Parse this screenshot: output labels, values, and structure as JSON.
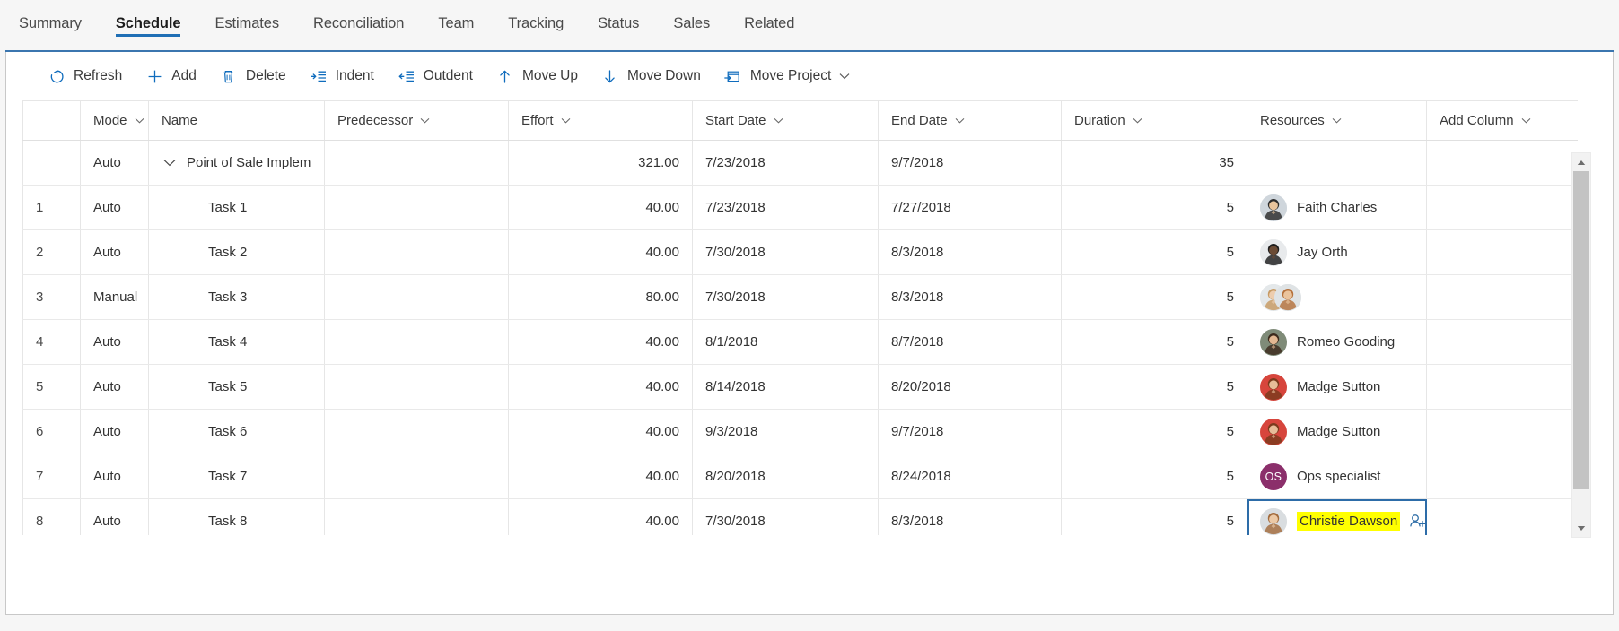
{
  "tabs": [
    {
      "label": "Summary",
      "active": false
    },
    {
      "label": "Schedule",
      "active": true
    },
    {
      "label": "Estimates",
      "active": false
    },
    {
      "label": "Reconciliation",
      "active": false
    },
    {
      "label": "Team",
      "active": false
    },
    {
      "label": "Tracking",
      "active": false
    },
    {
      "label": "Status",
      "active": false
    },
    {
      "label": "Sales",
      "active": false
    },
    {
      "label": "Related",
      "active": false
    }
  ],
  "toolbar": {
    "refresh_label": "Refresh",
    "add_label": "Add",
    "delete_label": "Delete",
    "indent_label": "Indent",
    "outdent_label": "Outdent",
    "move_up_label": "Move Up",
    "move_down_label": "Move Down",
    "move_project_label": "Move Project"
  },
  "grid": {
    "columns": [
      {
        "label": "",
        "chevron": false
      },
      {
        "label": "Mode",
        "chevron": true
      },
      {
        "label": "Name",
        "chevron": false
      },
      {
        "label": "Predecessor",
        "chevron": true
      },
      {
        "label": "Effort",
        "chevron": true
      },
      {
        "label": "Start Date",
        "chevron": true
      },
      {
        "label": "End Date",
        "chevron": true
      },
      {
        "label": "Duration",
        "chevron": true
      },
      {
        "label": "Resources",
        "chevron": true
      },
      {
        "label": "Add Column",
        "chevron": true
      }
    ],
    "rows": [
      {
        "no": "",
        "mode": "Auto",
        "name": "Point of Sale Implementat",
        "is_summary": true,
        "predecessor": "",
        "effort": "321.00",
        "start": "7/23/2018",
        "end": "9/7/2018",
        "duration": "35",
        "resource": "",
        "avatar": "none"
      },
      {
        "no": "1",
        "mode": "Auto",
        "name": "Task 1",
        "is_summary": false,
        "predecessor": "",
        "effort": "40.00",
        "start": "7/23/2018",
        "end": "7/27/2018",
        "duration": "5",
        "resource": "Faith Charles",
        "avatar": "photo-woman-1"
      },
      {
        "no": "2",
        "mode": "Auto",
        "name": "Task 2",
        "is_summary": false,
        "predecessor": "",
        "effort": "40.00",
        "start": "7/30/2018",
        "end": "8/3/2018",
        "duration": "5",
        "resource": "Jay Orth",
        "avatar": "photo-man-1"
      },
      {
        "no": "3",
        "mode": "Manual",
        "name": "Task 3",
        "is_summary": false,
        "predecessor": "",
        "effort": "80.00",
        "start": "7/30/2018",
        "end": "8/3/2018",
        "duration": "5",
        "resource": "",
        "avatar": "photo-pair"
      },
      {
        "no": "4",
        "mode": "Auto",
        "name": "Task 4",
        "is_summary": false,
        "predecessor": "",
        "effort": "40.00",
        "start": "8/1/2018",
        "end": "8/7/2018",
        "duration": "5",
        "resource": "Romeo Gooding",
        "avatar": "photo-man-2"
      },
      {
        "no": "5",
        "mode": "Auto",
        "name": "Task 5",
        "is_summary": false,
        "predecessor": "",
        "effort": "40.00",
        "start": "8/14/2018",
        "end": "8/20/2018",
        "duration": "5",
        "resource": "Madge Sutton",
        "avatar": "photo-woman-2"
      },
      {
        "no": "6",
        "mode": "Auto",
        "name": "Task 6",
        "is_summary": false,
        "predecessor": "",
        "effort": "40.00",
        "start": "9/3/2018",
        "end": "9/7/2018",
        "duration": "5",
        "resource": "Madge Sutton",
        "avatar": "photo-woman-2"
      },
      {
        "no": "7",
        "mode": "Auto",
        "name": "Task 7",
        "is_summary": false,
        "predecessor": "",
        "effort": "40.00",
        "start": "8/20/2018",
        "end": "8/24/2018",
        "duration": "5",
        "resource": "Ops specialist",
        "avatar": "initials",
        "initials": "OS"
      },
      {
        "no": "8",
        "mode": "Auto",
        "name": "Task 8",
        "is_summary": false,
        "predecessor": "",
        "effort": "40.00",
        "start": "7/30/2018",
        "end": "8/3/2018",
        "duration": "5",
        "resource": "Christie Dawson",
        "avatar": "photo-woman-3",
        "selected": true,
        "highlighted": true
      }
    ]
  },
  "colors": {
    "accent": "#0078d4",
    "tab_underline": "#1f6fb5",
    "panel_topline": "#3b76af",
    "selection_border": "#2d6ca8",
    "highlight": "#ffff00",
    "initials_bg": "#8b2f6b"
  },
  "scrollbar": {
    "up_arrow": "scroll-up-arrow",
    "down_arrow": "scroll-down-arrow"
  }
}
